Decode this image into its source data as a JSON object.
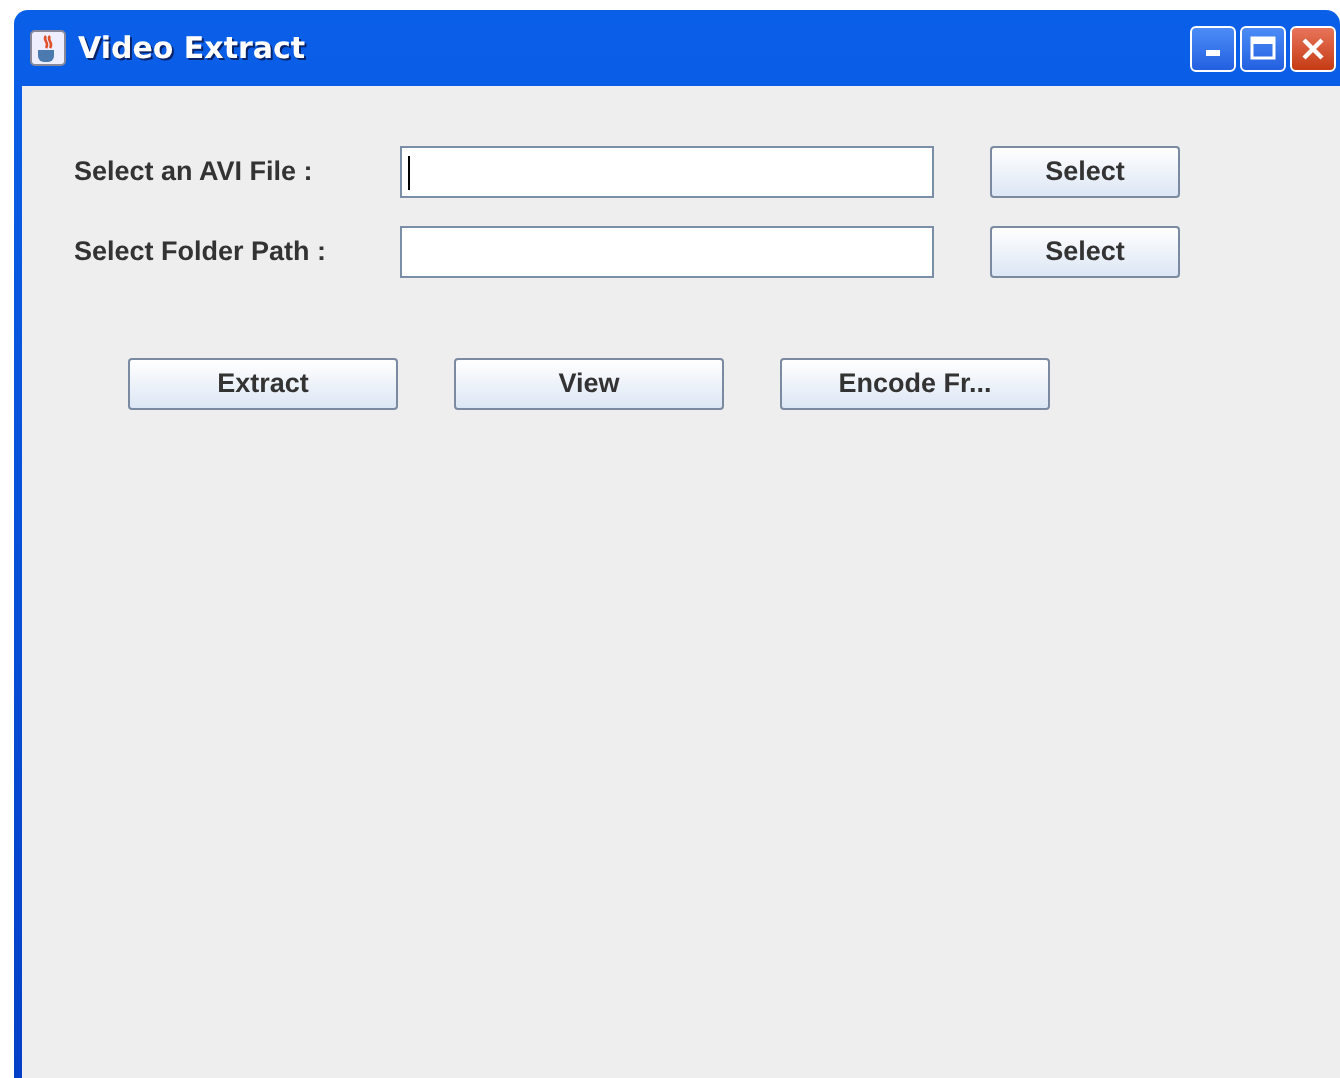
{
  "window": {
    "title": "Video Extract"
  },
  "fields": [
    {
      "label": "Select an AVI File :",
      "focused": true,
      "button": "Select"
    },
    {
      "label": "Select Folder Path :",
      "focused": false,
      "button": "Select"
    }
  ],
  "actions": [
    "Extract",
    "View",
    "Encode Fr..."
  ]
}
